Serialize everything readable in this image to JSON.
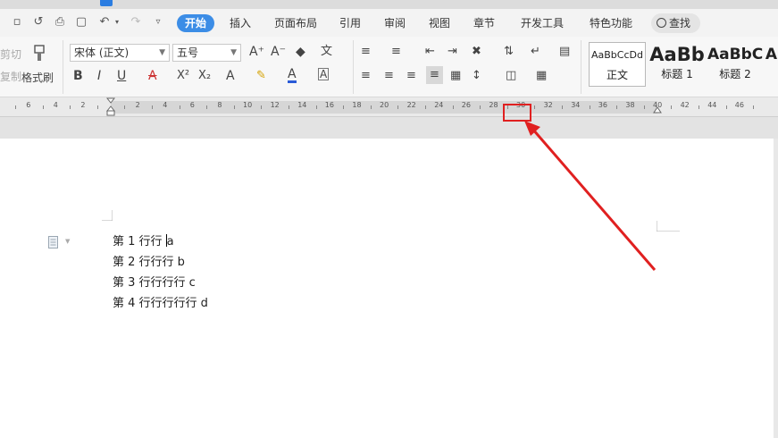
{
  "menu": {
    "tabs": [
      {
        "label": "开始",
        "active": true
      },
      {
        "label": "插入"
      },
      {
        "label": "页面布局"
      },
      {
        "label": "引用"
      },
      {
        "label": "审阅"
      },
      {
        "label": "视图"
      },
      {
        "label": "章节"
      },
      {
        "label": "开发工具"
      },
      {
        "label": "特色功能"
      }
    ],
    "search_label": "查找"
  },
  "ribbon": {
    "cut_label": "剪切",
    "copy_label": "复制",
    "format_painter_label": "格式刷",
    "font_name": "宋体 (正文)",
    "font_size": "五号",
    "styles": [
      {
        "sample": "AaBbCcDd",
        "name": "正文"
      },
      {
        "sample": "AaBb",
        "name": "标题 1"
      },
      {
        "sample": "AaBbC",
        "name": "标题 2"
      }
    ]
  },
  "ruler": {
    "labels_left": [
      "6",
      "4",
      "2"
    ],
    "labels_right": [
      "2",
      "4",
      "6",
      "8",
      "10",
      "12",
      "14",
      "16",
      "18",
      "20",
      "22",
      "24",
      "26",
      "28",
      "30",
      "32",
      "34",
      "36",
      "38",
      "40",
      "42",
      "44",
      "46"
    ]
  },
  "document": {
    "lines": [
      "第 1 行行 ",
      "第 2 行行行 b",
      "第 3 行行行行 c",
      "第 4 行行行行行 d"
    ],
    "line1_tail": "a"
  },
  "colors": {
    "accent": "#3c8de6",
    "annotation": "#e02020"
  }
}
